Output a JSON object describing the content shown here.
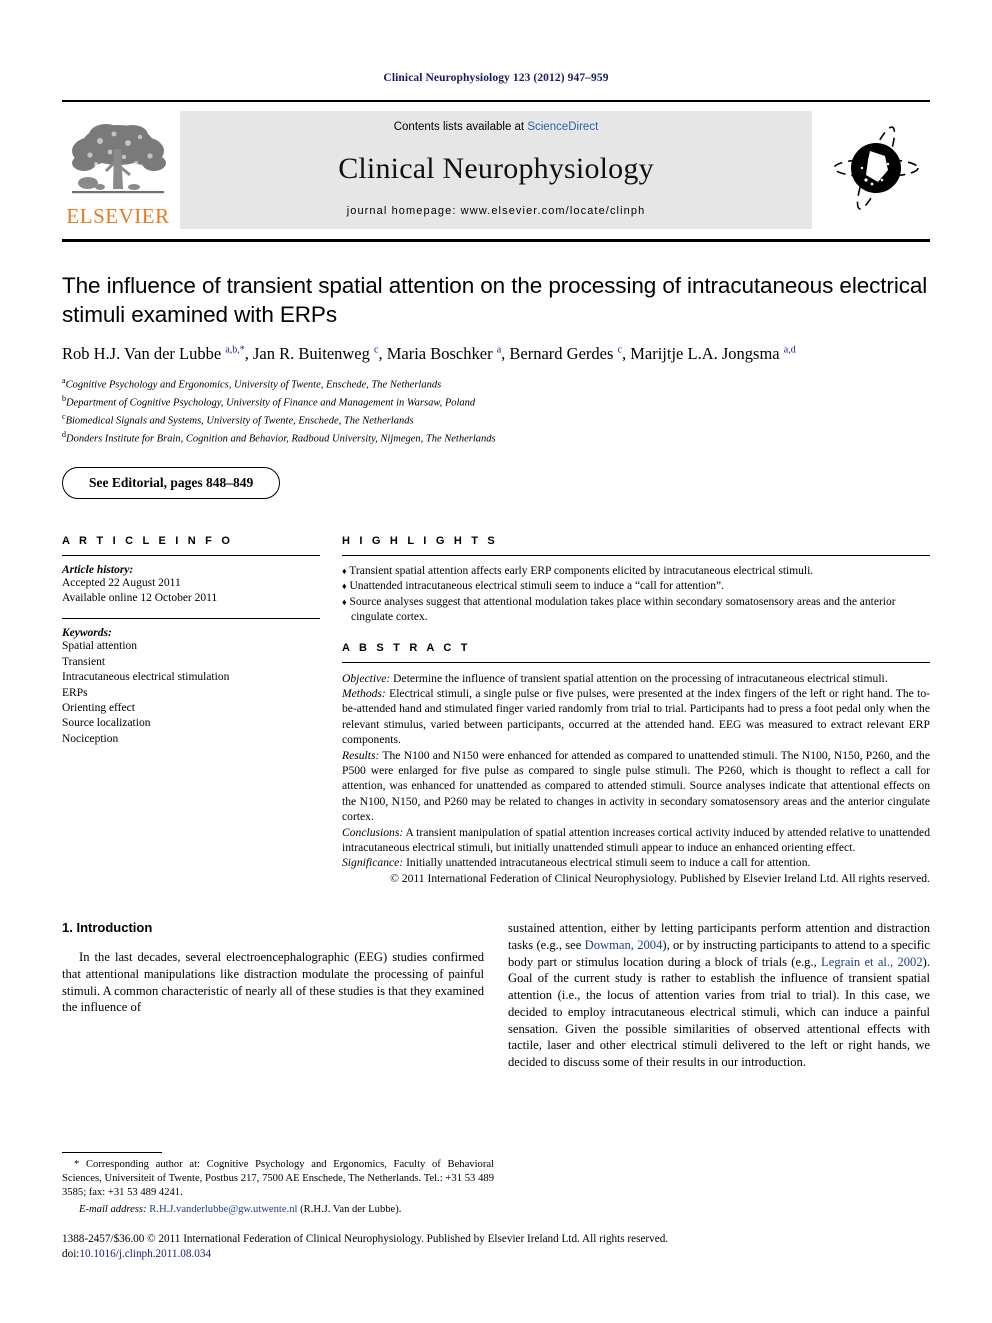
{
  "running_head": "Clinical Neurophysiology 123 (2012) 947–959",
  "masthead": {
    "publisher_logo_text": "ELSEVIER",
    "contents_prefix": "Contents lists available at ",
    "contents_link": "ScienceDirect",
    "journal_name": "Clinical Neurophysiology",
    "homepage": "journal homepage: www.elsevier.com/locate/clinph",
    "journal_mark_name": "globe-orbit-icon"
  },
  "article": {
    "title": "The influence of transient spatial attention on the processing of intracutaneous electrical stimuli examined with ERPs",
    "authors_html": "Rob H.J. Van der Lubbe <sup>a,b,*</sup>, Jan R. Buitenweg <sup>c</sup>, Maria Boschker <sup>a</sup>, Bernard Gerdes <sup>c</sup>, Marijtje L.A. Jongsma <sup>a,d</sup>",
    "affiliations": [
      {
        "marker": "a",
        "text": "Cognitive Psychology and Ergonomics, University of Twente, Enschede, The Netherlands"
      },
      {
        "marker": "b",
        "text": "Department of Cognitive Psychology, University of Finance and Management in Warsaw, Poland"
      },
      {
        "marker": "c",
        "text": "Biomedical Signals and Systems, University of Twente, Enschede, The Netherlands"
      },
      {
        "marker": "d",
        "text": "Donders Institute for Brain, Cognition and Behavior, Radboud University, Nijmegen, The Netherlands"
      }
    ],
    "editorial_note": "See Editorial, pages 848–849"
  },
  "article_info": {
    "heading": "A R T I C L E    I N F O",
    "history_label": "Article history:",
    "history_lines": [
      "Accepted 22 August 2011",
      "Available online 12 October 2011"
    ],
    "keywords_label": "Keywords:",
    "keywords": [
      "Spatial attention",
      "Transient",
      "Intracutaneous electrical stimulation",
      "ERPs",
      "Orienting effect",
      "Source localization",
      "Nociception"
    ]
  },
  "highlights": {
    "heading": "H I G H L I G H T S",
    "bullet_glyph": "♦",
    "items": [
      "Transient spatial attention affects early ERP components elicited by intracutaneous electrical stimuli.",
      "Unattended intracutaneous electrical stimuli seem to induce a “call for attention”.",
      "Source analyses suggest that attentional modulation takes place within secondary somatosensory areas and the anterior cingulate cortex."
    ]
  },
  "abstract": {
    "heading": "A B S T R A C T",
    "sections": [
      {
        "label": "Objective:",
        "text": " Determine the influence of transient spatial attention on the processing of intracutaneous electrical stimuli."
      },
      {
        "label": "Methods:",
        "text": " Electrical stimuli, a single pulse or five pulses, were presented at the index fingers of the left or right hand. The to-be-attended hand and stimulated finger varied randomly from trial to trial. Participants had to press a foot pedal only when the relevant stimulus, varied between participants, occurred at the attended hand. EEG was measured to extract relevant ERP components."
      },
      {
        "label": "Results:",
        "text": " The N100 and N150 were enhanced for attended as compared to unattended stimuli. The N100, N150, P260, and the P500 were enlarged for five pulse as compared to single pulse stimuli. The P260, which is thought to reflect a call for attention, was enhanced for unattended as compared to attended stimuli. Source analyses indicate that attentional effects on the N100, N150, and P260 may be related to changes in activity in secondary somatosensory areas and the anterior cingulate cortex."
      },
      {
        "label": "Conclusions:",
        "text": " A transient manipulation of spatial attention increases cortical activity induced by attended relative to unattended intracutaneous electrical stimuli, but initially unattended stimuli appear to induce an enhanced orienting effect."
      },
      {
        "label": "Significance:",
        "text": " Initially unattended intracutaneous electrical stimuli seem to induce a call for attention."
      }
    ],
    "copyright": "© 2011 International Federation of Clinical Neurophysiology. Published by Elsevier Ireland Ltd. All rights reserved."
  },
  "body": {
    "section_number_title": "1. Introduction",
    "left_paragraph": "In the last decades, several electroencephalographic (EEG) studies confirmed that attentional manipulations like distraction modulate the processing of painful stimuli. A common characteristic of nearly all of these studies is that they examined the influence of",
    "right_paragraph_parts": [
      {
        "type": "text",
        "value": "sustained attention, either by letting participants perform attention and distraction tasks (e.g., see "
      },
      {
        "type": "cite",
        "value": "Dowman, 2004"
      },
      {
        "type": "text",
        "value": "), or by instructing participants to attend to a specific body part or stimulus location during a block of trials (e.g., "
      },
      {
        "type": "cite",
        "value": "Legrain et al., 2002"
      },
      {
        "type": "text",
        "value": "). Goal of the current study is rather to establish the influence of transient spatial attention (i.e., the locus of attention varies from trial to trial). In this case, we decided to employ intracutaneous electrical stimuli, which can induce a painful sensation. Given the possible similarities of observed attentional effects with tactile, laser and other electrical stimuli delivered to the left or right hands, we decided to discuss some of their results in our introduction."
      }
    ]
  },
  "footnotes": {
    "corresponding_marker": "*",
    "corresponding_text": " Corresponding author at: Cognitive Psychology and Ergonomics, Faculty of Behavioral Sciences, Universiteit of Twente, Postbus 217, 7500 AE Enschede, The Netherlands. Tel.: +31 53 489 3585; fax: +31 53 489 4241.",
    "email_label": "E-mail address:",
    "email_address": "R.H.J.vanderlubbe@gw.utwente.nl",
    "email_suffix": " (R.H.J. Van der Lubbe)."
  },
  "page_footer": {
    "issn_line": "1388-2457/$36.00 © 2011 International Federation of Clinical Neurophysiology. Published by Elsevier Ireland Ltd. All rights reserved.",
    "doi_label": "doi:",
    "doi_value": "10.1016/j.clinph.2011.08.034"
  },
  "colors": {
    "running_head": "#1a1a5e",
    "elsevier_orange": "#E77B22",
    "link_blue": "#2b5faa",
    "citation_blue": "#1a3f86",
    "masthead_bg": "#e6e6e6"
  }
}
